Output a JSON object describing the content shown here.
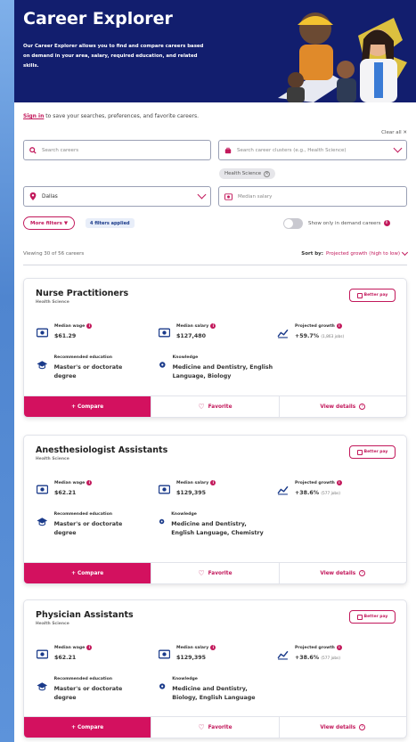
{
  "hero": {
    "title": "Career Explorer",
    "description": "Our Career Explorer allows you to find and compare careers based on demand in your area, salary, required education, and related skills."
  },
  "signin": {
    "link": "Sign in",
    "text": " to save your searches, preferences, and favorite careers."
  },
  "clear_all": "Clear all ✕",
  "search": {
    "placeholder": "Search careers"
  },
  "clusters": {
    "placeholder": "Search career clusters (e.g., Health Science)"
  },
  "cluster_chip": "Health Science",
  "location": {
    "value": "Dallas"
  },
  "salary": {
    "placeholder": "Median salary"
  },
  "more_filters": "More filters ▼",
  "filters_applied": "4 filters applied",
  "in_demand_label": "Show only in demand careers",
  "viewing": "Viewing 30 of 56 careers",
  "sort": {
    "label": "Sort by:",
    "value": "Projected growth (high to low)"
  },
  "labels": {
    "median_wage": "Median wage",
    "median_salary": "Median salary",
    "projected_growth": "Projected growth",
    "education": "Recommended education",
    "knowledge": "Knowledge",
    "better_pay": "Better pay",
    "compare": "+ Compare",
    "favorite": "Favorite",
    "view_details": "View details"
  },
  "careers": [
    {
      "title": "Nurse Practitioners",
      "cluster": "Health Science",
      "wage": "$61.29",
      "salary": "$127,480",
      "growth": "+59.7%",
      "jobs": "(1,863 jobs)",
      "education": "Master's or doctorate degree",
      "knowledge": "Medicine and Dentistry, English Language, Biology"
    },
    {
      "title": "Anesthesiologist Assistants",
      "cluster": "Health Science",
      "wage": "$62.21",
      "salary": "$129,395",
      "growth": "+38.6%",
      "jobs": "(577 jobs)",
      "education": "Master's or doctorate degree",
      "knowledge": "Medicine and Dentistry, English Language, Chemistry"
    },
    {
      "title": "Physician Assistants",
      "cluster": "Health Science",
      "wage": "$62.21",
      "salary": "$129,395",
      "growth": "+38.6%",
      "jobs": "(577 jobs)",
      "education": "Master's or doctorate degree",
      "knowledge": "Medicine and Dentistry, Biology, English Language"
    }
  ],
  "colors": {
    "brand_navy": "#121e6e",
    "accent_pink": "#d3115f"
  }
}
